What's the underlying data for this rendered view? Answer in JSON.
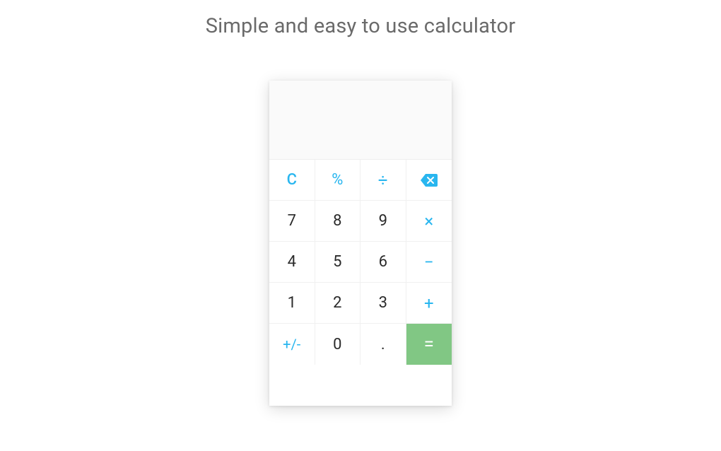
{
  "heading": "Simple and easy to use calculator",
  "calculator": {
    "display": "",
    "keys": {
      "clear": "C",
      "percent": "%",
      "divide": "÷",
      "backspace": "⌫",
      "seven": "7",
      "eight": "8",
      "nine": "9",
      "multiply": "×",
      "four": "4",
      "five": "5",
      "six": "6",
      "minus": "−",
      "one": "1",
      "two": "2",
      "three": "3",
      "plus": "+",
      "sign": "+/-",
      "zero": "0",
      "decimal": ".",
      "equals": "="
    }
  },
  "colors": {
    "accent": "#29b6ef",
    "equals_bg": "#81c784",
    "heading": "#6a6a6a",
    "digit": "#2a2a2a"
  }
}
